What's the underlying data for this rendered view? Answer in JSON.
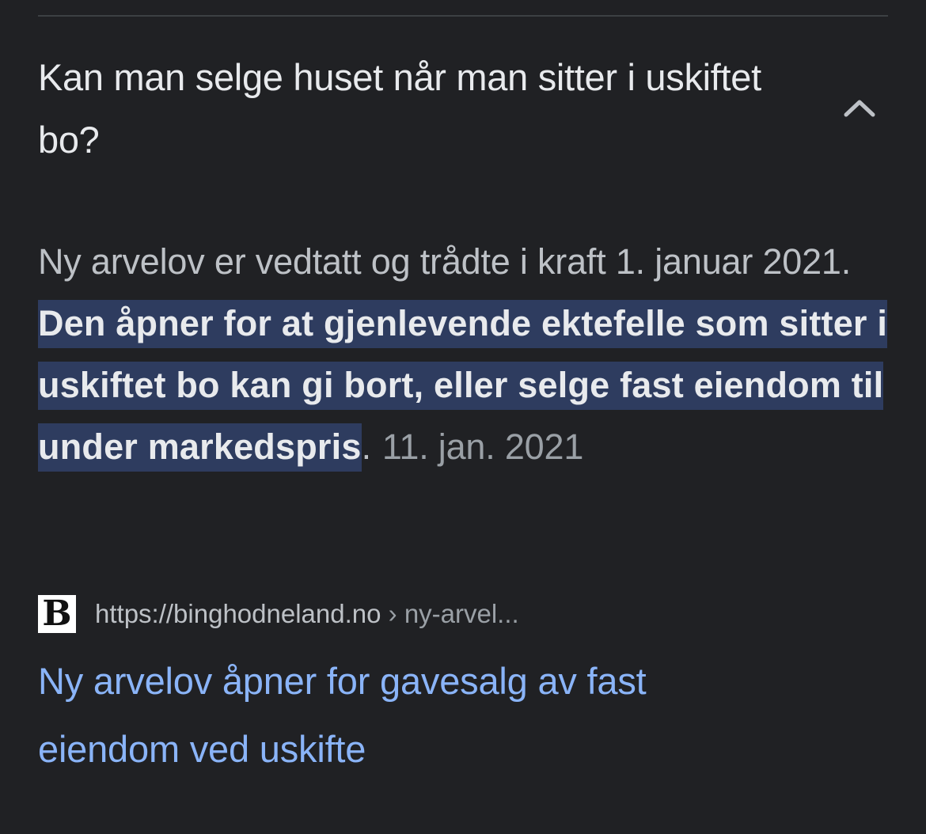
{
  "faq": {
    "question": "Kan man selge huset når man sitter i uskiftet bo?",
    "answer_intro": "Ny arvelov er vedtatt og trådte i kraft 1. januar 2021.",
    "answer_highlight": "Den åpner for at gjenlevende ektefelle som sitter i uskiftet bo kan gi bort, eller selge fast eiendom til under markedspris",
    "answer_end": ".",
    "date": "11. jan. 2021",
    "collapse_icon": "chevron-up-icon",
    "favicon_letter": "B",
    "source_url": "https://binghodneland.no",
    "source_breadcrumb": "› ny-arvel...",
    "result_title": "Ny arvelov åpner for gavesalg av fast eiendom ved uskifte"
  },
  "colors": {
    "background": "#202124",
    "highlight": "#2e3c5f",
    "link": "#8ab4f8"
  }
}
